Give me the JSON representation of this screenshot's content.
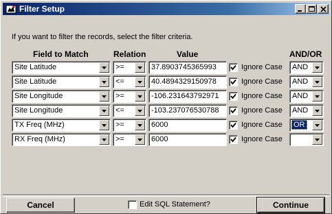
{
  "window": {
    "title": "Filter Setup",
    "icon": "app-icon",
    "controls": [
      "minimize-icon",
      "maximize-icon",
      "close-icon"
    ]
  },
  "intro_text": "If you want to filter the records, select the filter criteria.",
  "headers": {
    "field": "Field to Match",
    "relation": "Relation",
    "value": "Value",
    "andor": "AND/OR"
  },
  "rows": [
    {
      "field": "Site Latitude",
      "relation": ">=",
      "value": "37.8903745365993",
      "ignore_case": true,
      "ignore_label": "Ignore Case",
      "andor": "AND"
    },
    {
      "field": "Site Latitude",
      "relation": "<=",
      "value": "40.4894329150978",
      "ignore_case": true,
      "ignore_label": "Ignore Case",
      "andor": "AND"
    },
    {
      "field": "Site Longitude",
      "relation": ">=",
      "value": "-106.231643792971",
      "ignore_case": true,
      "ignore_label": "Ignore Case",
      "andor": "AND"
    },
    {
      "field": "Site Longitude",
      "relation": "<=",
      "value": "-103.237076530788",
      "ignore_case": true,
      "ignore_label": "Ignore Case",
      "andor": "AND"
    },
    {
      "field": "TX Freq (MHz)",
      "relation": ">=",
      "value": "6000",
      "ignore_case": true,
      "ignore_label": "Ignore Case",
      "andor": "OR"
    },
    {
      "field": "RX Freq (MHz)",
      "relation": ">=",
      "value": "6000",
      "ignore_case": true,
      "ignore_label": "Ignore Case",
      "andor": ""
    }
  ],
  "footer": {
    "cancel_label": "Cancel",
    "edit_sql_label": "Edit SQL Statement?",
    "edit_sql_checked": false,
    "continue_label": "Continue"
  },
  "colors": {
    "title_start": "#0a246a",
    "title_end": "#a6caf0",
    "face": "#d4d0c8",
    "selection": "#0a246a"
  }
}
